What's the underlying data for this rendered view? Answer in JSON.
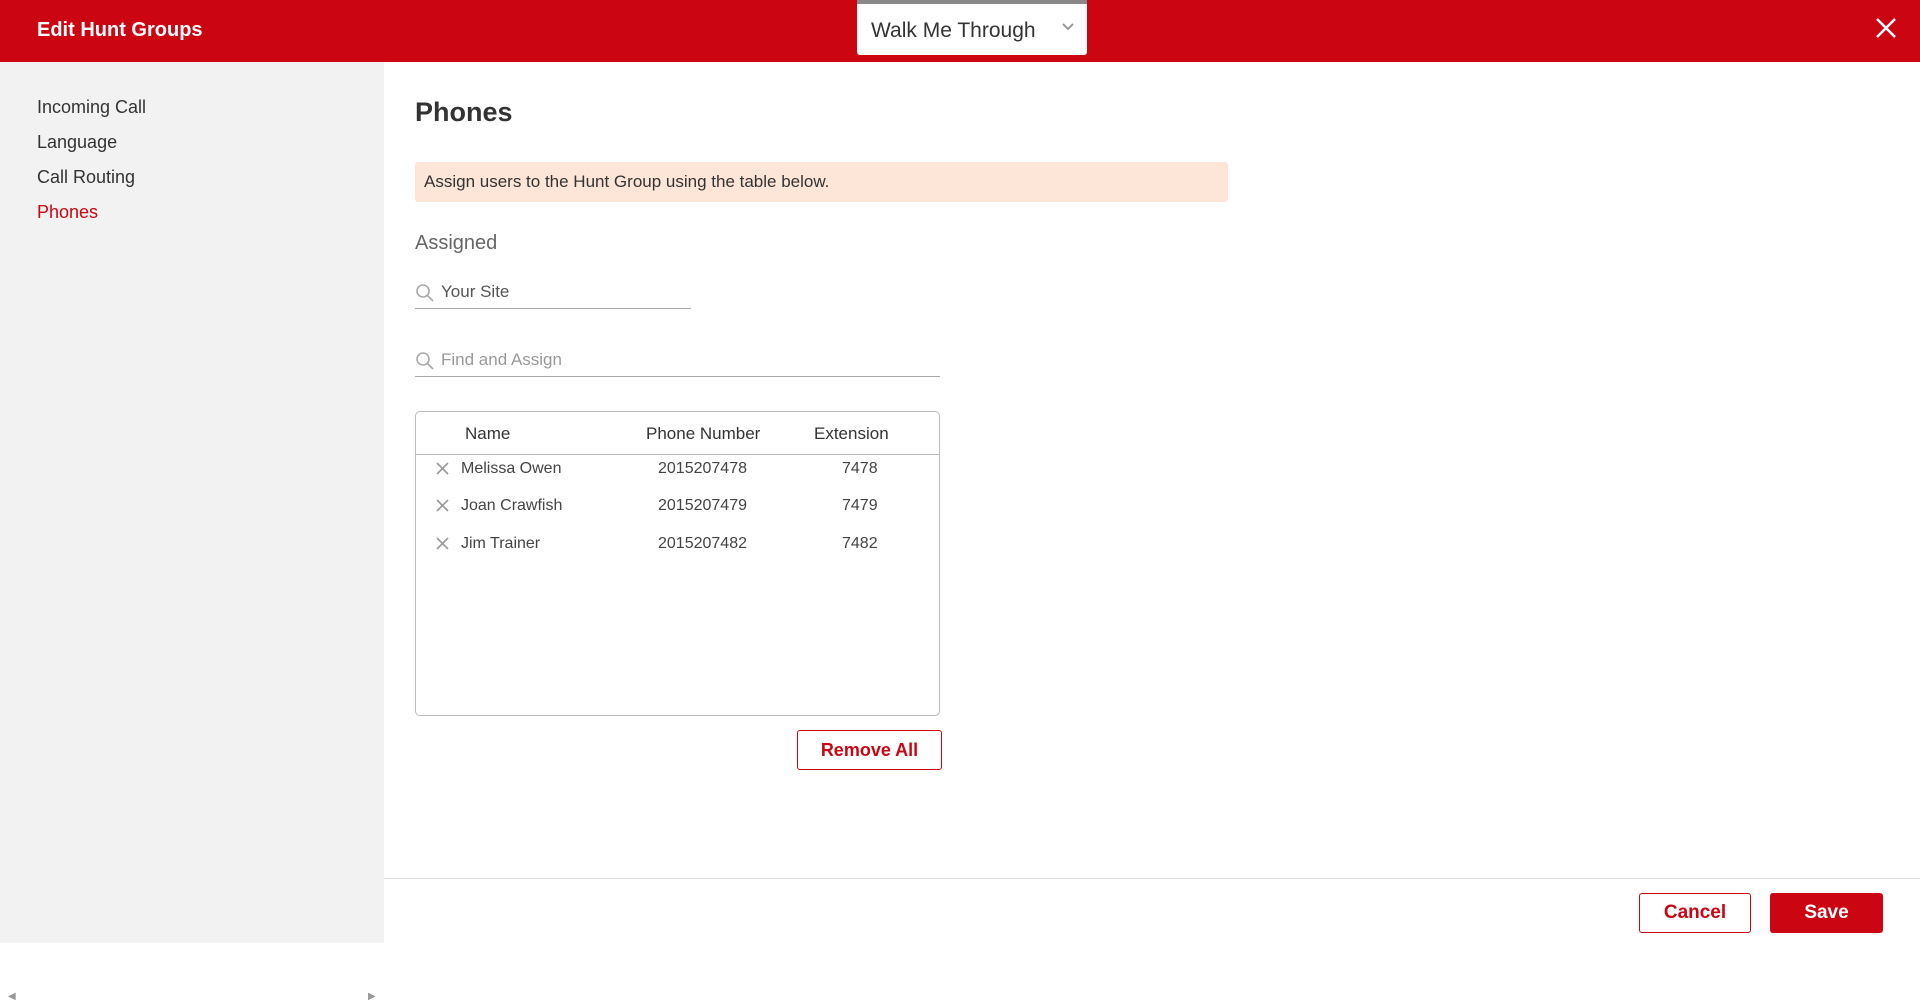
{
  "header": {
    "title": "Edit Hunt Groups",
    "walk_me_through": "Walk Me Through",
    "close_icon": "close-icon",
    "accent_color": "#cc0512"
  },
  "sidebar": {
    "items": [
      {
        "label": "Incoming Call",
        "active": false
      },
      {
        "label": "Language",
        "active": false
      },
      {
        "label": "Call Routing",
        "active": false
      },
      {
        "label": "Phones",
        "active": true
      }
    ]
  },
  "main": {
    "title": "Phones",
    "info_banner": "Assign users to the Hunt Group using the table below.",
    "section_label": "Assigned",
    "site_search": {
      "placeholder": "Your Site",
      "icon": "search-icon"
    },
    "assign_search": {
      "placeholder": "Find and Assign",
      "icon": "search-icon"
    },
    "table": {
      "headers": {
        "name": "Name",
        "phone": "Phone Number",
        "extension": "Extension"
      },
      "rows": [
        {
          "name": "Melissa Owen",
          "phone": "2015207478",
          "extension": "7478"
        },
        {
          "name": "Joan Crawfish",
          "phone": "2015207479",
          "extension": "7479"
        },
        {
          "name": "Jim Trainer",
          "phone": "2015207482",
          "extension": "7482"
        }
      ]
    },
    "remove_all_label": "Remove All"
  },
  "footer": {
    "cancel_label": "Cancel",
    "save_label": "Save"
  }
}
